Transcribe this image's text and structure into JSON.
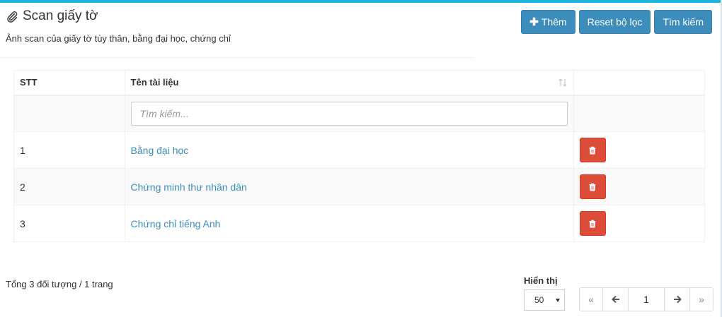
{
  "header": {
    "title": "Scan giấy tờ",
    "subtitle": "Ảnh scan của giấy tờ tùy thân, bằng đại học, chứng chỉ"
  },
  "toolbar": {
    "add_label": "Thêm",
    "reset_label": "Reset bộ lọc",
    "search_label": "Tìm kiếm"
  },
  "table": {
    "columns": [
      "STT",
      "Tên tài liệu",
      ""
    ],
    "filter_placeholder": "Tìm kiếm...",
    "rows": [
      {
        "stt": "1",
        "name": "Bằng đại học"
      },
      {
        "stt": "2",
        "name": "Chứng minh thư nhân dân"
      },
      {
        "stt": "3",
        "name": "Chứng chỉ tiếng Anh"
      }
    ]
  },
  "footer": {
    "total": "Tổng 3 đối tượng / 1 trang",
    "page_size_label": "Hiển thị",
    "page_size": "50",
    "current_page": "1"
  },
  "icons": {
    "title": "paperclip-icon",
    "add": "plus-icon",
    "sort": "sort-icon",
    "delete": "trash-icon",
    "first": "double-chevron-left-icon",
    "prev": "arrow-left-icon",
    "next": "arrow-right-icon",
    "last": "double-chevron-right-icon"
  },
  "colors": {
    "primary": "#3c8dbc",
    "danger": "#dd4b39",
    "top_accent": "#1cb5e0"
  }
}
